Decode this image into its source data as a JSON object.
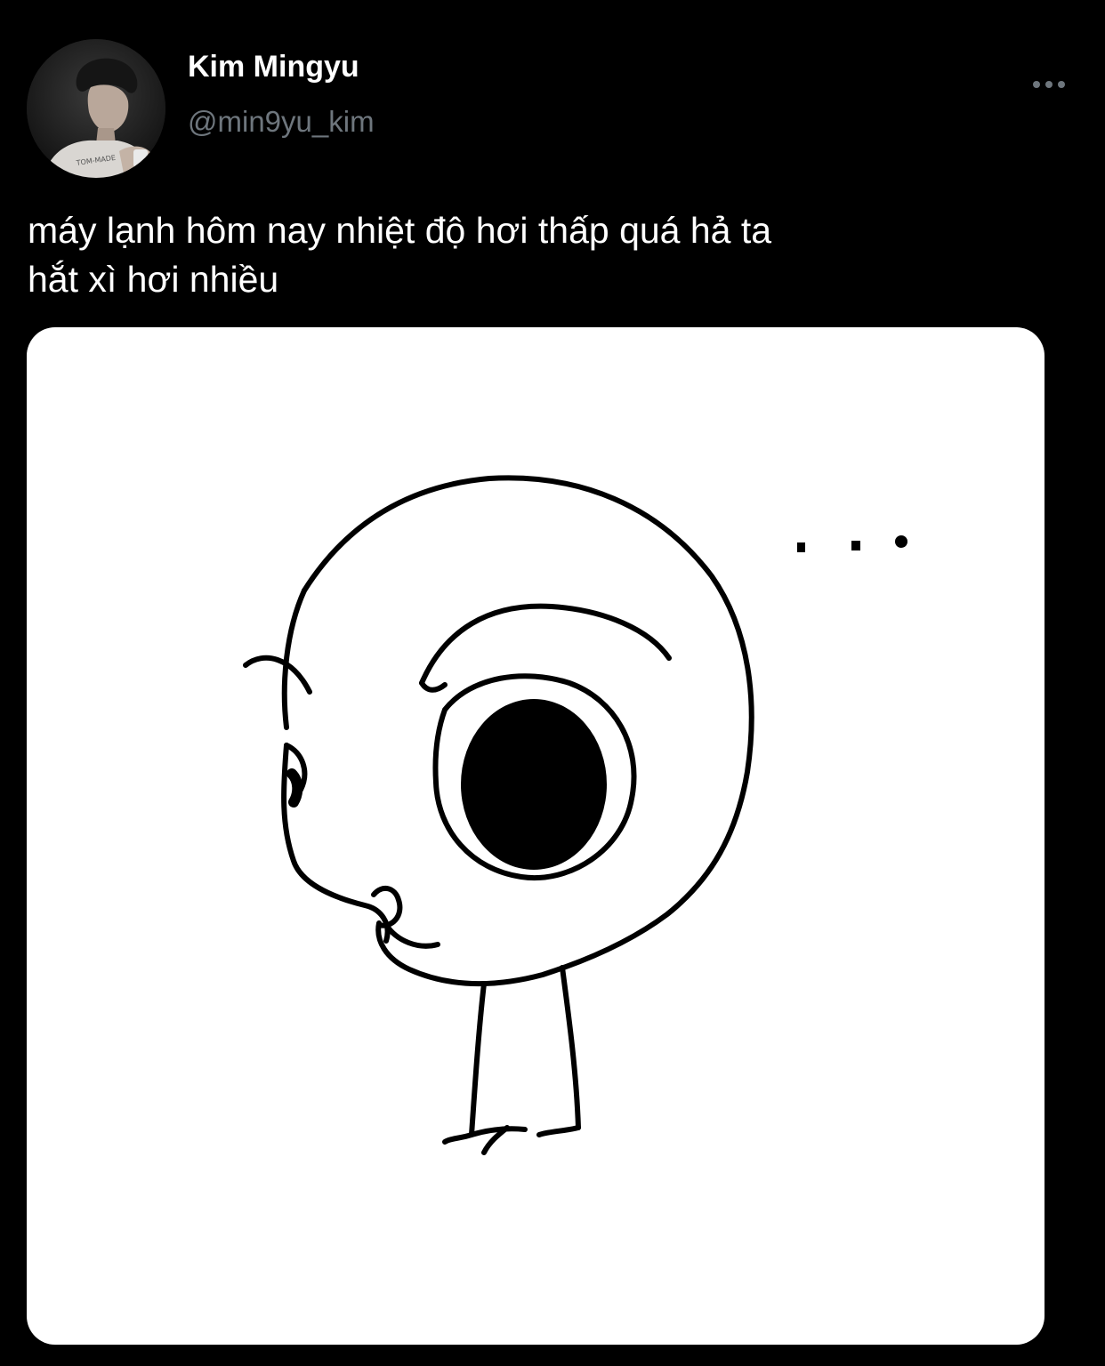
{
  "tweet": {
    "author": {
      "display_name": "Kim Mingyu",
      "handle": "@min9yu_kim",
      "avatar_icon": "profile-photo"
    },
    "more_icon": "more-horizontal-icon",
    "text_lines": [
      "máy lạnh hôm nay nhiệt độ hơi thấp quá hả ta",
      "hắt xì hơi nhiều"
    ],
    "media": {
      "type": "image",
      "description_icon": "doodle-character-illustration"
    }
  },
  "colors": {
    "background": "#000000",
    "text_primary": "#ffffff",
    "text_secondary": "#6e767d",
    "media_background": "#ffffff"
  }
}
